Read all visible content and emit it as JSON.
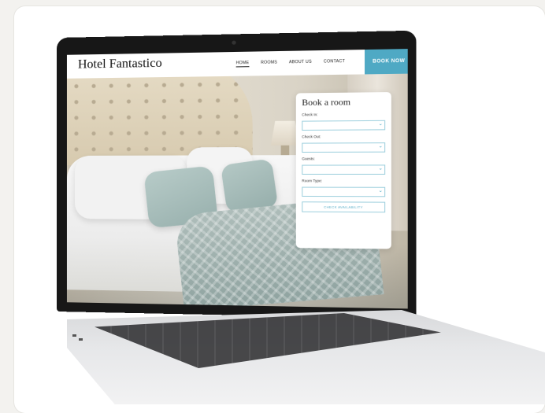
{
  "site": {
    "logo": "Hotel Fantastico",
    "nav": [
      "HOME",
      "ROOMS",
      "ABOUT US",
      "CONTACT"
    ],
    "active_nav": "HOME",
    "cta": "BOOK NOW"
  },
  "booking": {
    "title": "Book a room",
    "fields": [
      {
        "label": "Check In:",
        "value": ""
      },
      {
        "label": "Check Out:",
        "value": ""
      },
      {
        "label": "Guests:",
        "value": ""
      },
      {
        "label": "Room Type:",
        "value": ""
      }
    ],
    "submit": "CHECK AVAILABILITY"
  },
  "colors": {
    "accent": "#4fa9c4",
    "page_bg": "#f3f2ef",
    "card_bg": "#ffffff"
  },
  "icons": {
    "select_chevron": "chevron-down-icon"
  }
}
